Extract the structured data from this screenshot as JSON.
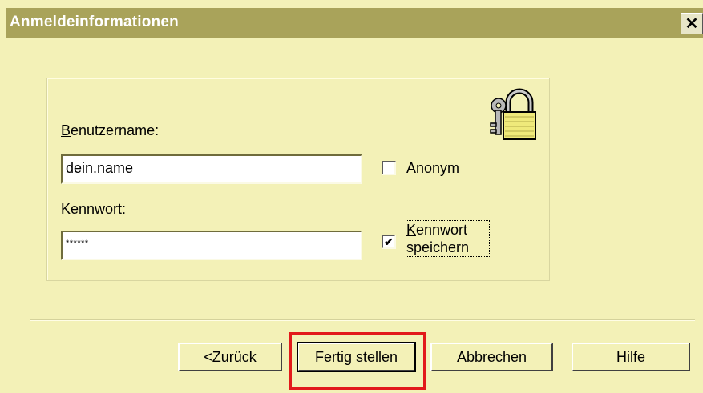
{
  "window": {
    "title": "Anmeldeinformationen",
    "close_label": "✕"
  },
  "form": {
    "username_label_accel": "B",
    "username_label_rest": "enutzername:",
    "username_value": "dein.name",
    "anonymous_accel": "A",
    "anonymous_rest": "nonym",
    "anonymous_checked": false,
    "password_label_accel": "K",
    "password_label_rest": "ennwort:",
    "password_value": "******",
    "save_password_accel": "K",
    "save_password_line1_rest": "ennwort",
    "save_password_line2": "speichern",
    "save_password_checked": true
  },
  "buttons": {
    "back_prefix": "< ",
    "back_accel": "Z",
    "back_rest": "urück",
    "finish": "Fertig stellen",
    "cancel": "Abbrechen",
    "help": "Hilfe"
  },
  "icons": {
    "lock": "lock-keys-icon",
    "checkmark": "✔"
  },
  "colors": {
    "title_bar": "#a9a35a",
    "window_bg": "#f3f1b7",
    "highlight": "#e21a1a"
  }
}
